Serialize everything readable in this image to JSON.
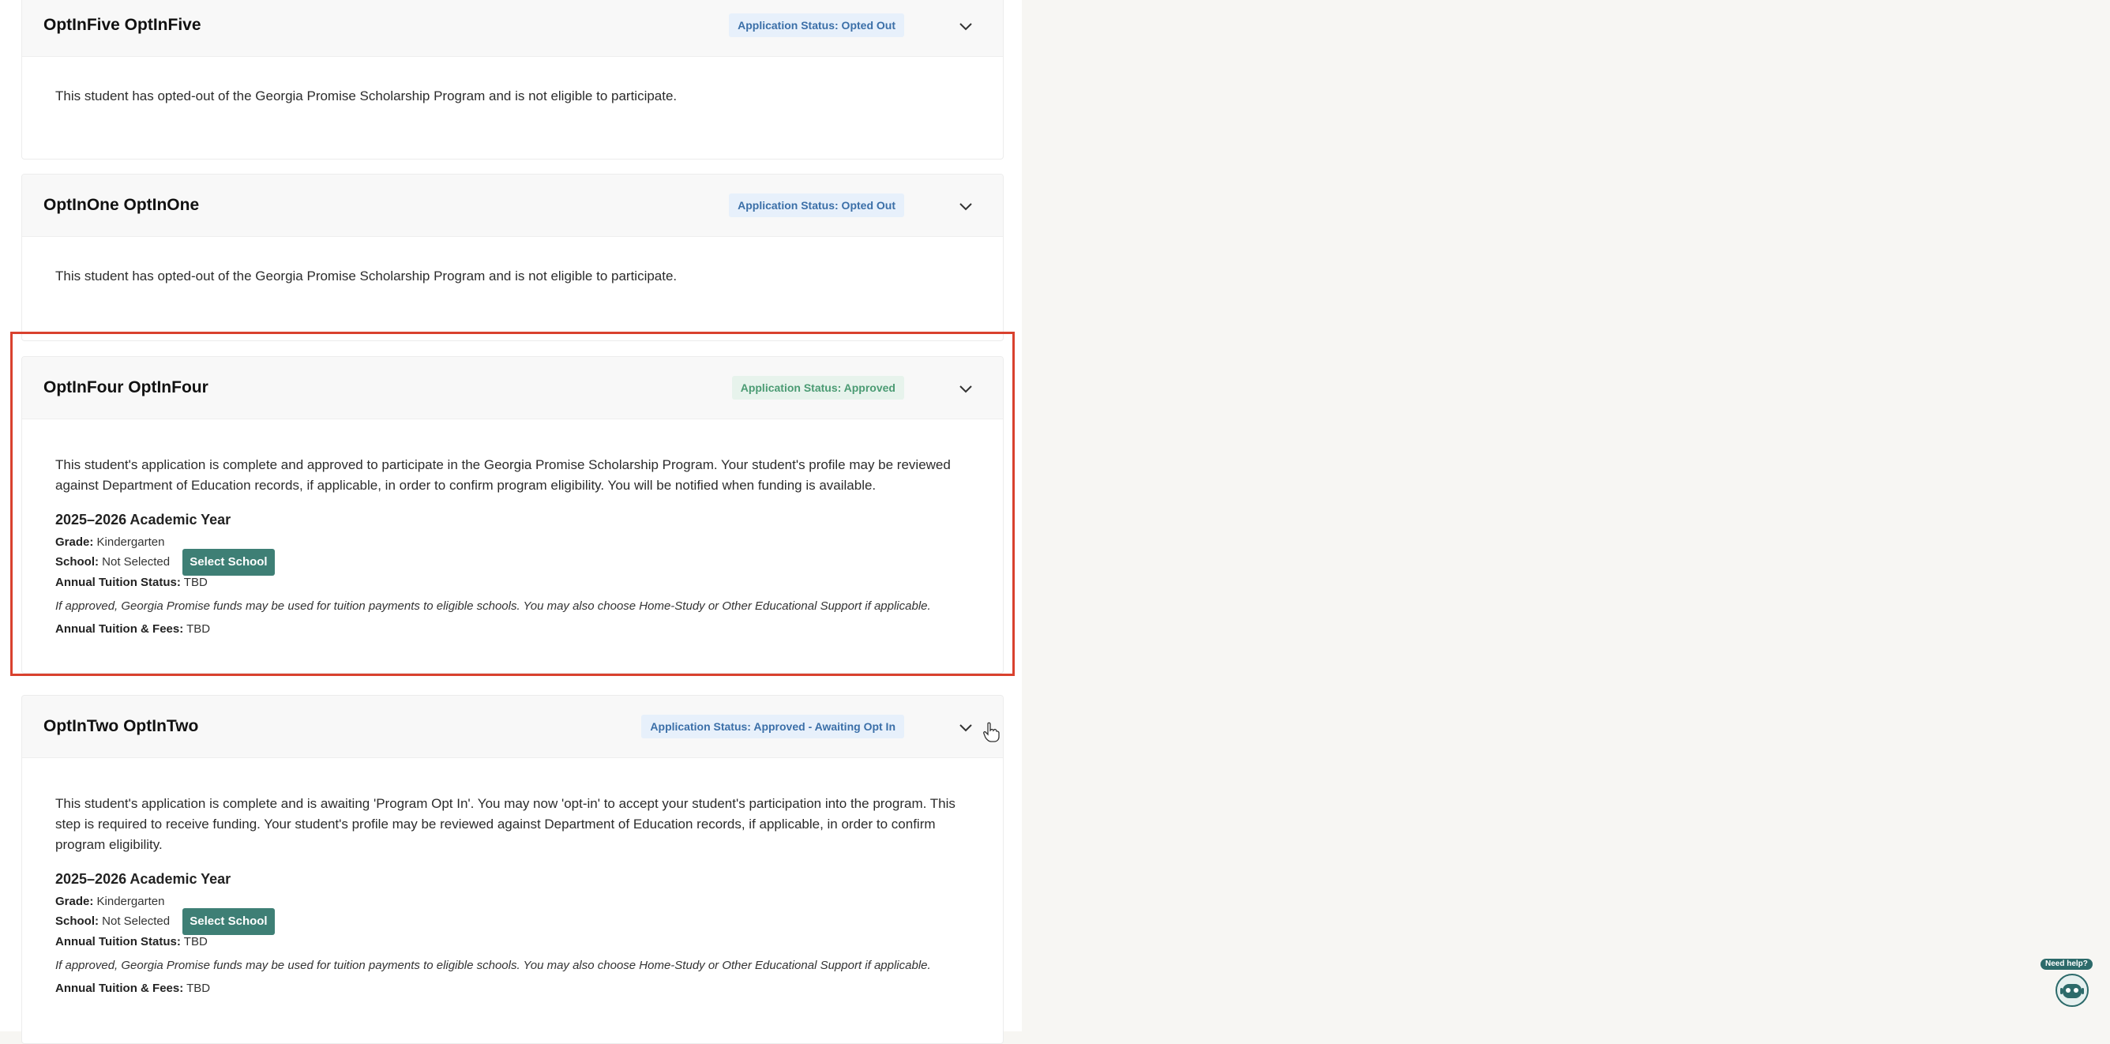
{
  "students": [
    {
      "name": "OptInFive OptInFive",
      "status": "Application Status: Opted Out",
      "message": "This student has opted-out of the Georgia Promise Scholarship Program and is not eligible to participate."
    },
    {
      "name": "OptInOne OptInOne",
      "status": "Application Status: Opted Out",
      "message": "This student has opted-out of the Georgia Promise Scholarship Program and is not eligible to participate."
    },
    {
      "name": "OptInFour OptInFour",
      "status": "Application Status: Approved",
      "message": "This student's application is complete and approved to participate in the Georgia Promise Scholarship Program. Your student's profile may be reviewed against Department of Education records, if applicable, in order to confirm program eligibility. You will be notified when funding is available.",
      "year": "2025–2026 Academic Year",
      "grade_label": "Grade:",
      "grade": "Kindergarten",
      "school_label": "School:",
      "school": "Not Selected",
      "select_button": "Select School",
      "tuition_status_label": "Annual Tuition Status:",
      "tuition_status": "TBD",
      "note": "If approved, Georgia Promise funds may be used for tuition payments to eligible schools. You may also choose Home-Study or Other Educational Support if applicable.",
      "fees_label": "Annual Tuition & Fees:",
      "fees": "TBD"
    },
    {
      "name": "OptInTwo OptInTwo",
      "status": "Application Status: Approved - Awaiting Opt In",
      "message": "This student's application is complete and is awaiting 'Program Opt In'. You may now 'opt-in' to accept your student's participation into the program. This step is required to receive funding. Your student's profile may be reviewed against Department of Education records, if applicable, in order to confirm program eligibility.",
      "year": "2025–2026 Academic Year",
      "grade_label": "Grade:",
      "grade": "Kindergarten",
      "school_label": "School:",
      "school": "Not Selected",
      "select_button": "Select School",
      "tuition_status_label": "Annual Tuition Status:",
      "tuition_status": "TBD",
      "note": "If approved, Georgia Promise funds may be used for tuition payments to eligible schools. You may also choose Home-Study or Other Educational Support if applicable.",
      "fees_label": "Annual Tuition & Fees:",
      "fees": "TBD"
    }
  ],
  "help_widget": {
    "label": "Need help?"
  },
  "colors": {
    "highlight": "#d9412e",
    "button": "#3e7f75",
    "badge_blue_text": "#3b6fa8",
    "badge_green_text": "#4b9b73"
  }
}
